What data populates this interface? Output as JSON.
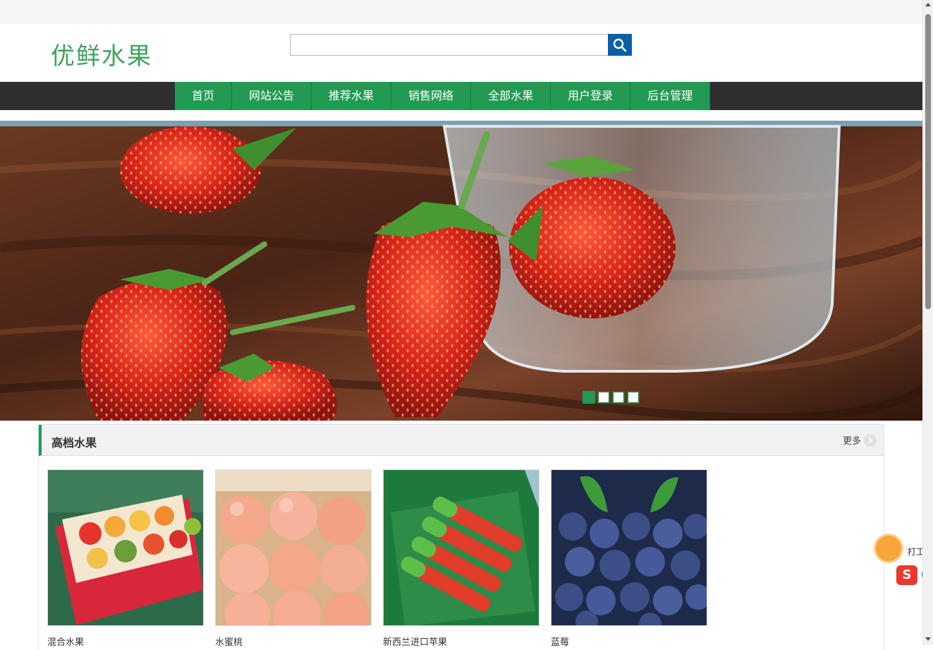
{
  "site": {
    "logo": "优鲜水果"
  },
  "search": {
    "value": "",
    "placeholder": ""
  },
  "nav": {
    "items": [
      "首页",
      "网站公告",
      "推荐水果",
      "销售网络",
      "全部水果",
      "用户登录",
      "后台管理"
    ]
  },
  "banner": {
    "dots": 4,
    "active_dot": 0
  },
  "section": {
    "title": "高档水果",
    "more": "更多",
    "products": [
      {
        "name": "混合水果"
      },
      {
        "name": "水蜜桃"
      },
      {
        "name": "新西兰进口苹果"
      },
      {
        "name": "蓝莓"
      }
    ]
  },
  "ime": {
    "label": "打工摸鱼",
    "mode": "中",
    "logo_letter": "S"
  },
  "colors": {
    "brand_green": "#229a52",
    "logo_green": "#3aa55c",
    "search_blue": "#0a5fa8",
    "nav_dark": "#2f2f2f"
  }
}
